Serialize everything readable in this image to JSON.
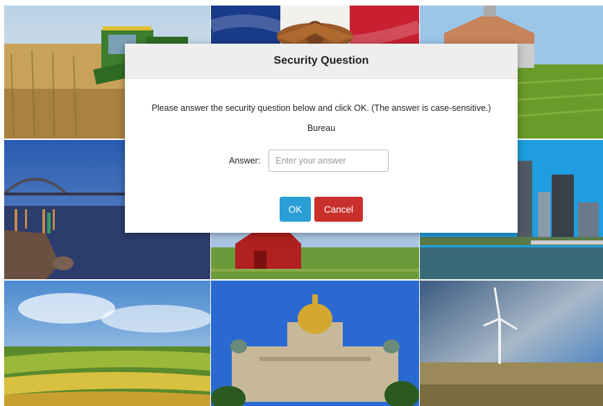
{
  "background": {
    "tiles": [
      {
        "name": "corn-harvest"
      },
      {
        "name": "iowa-flag"
      },
      {
        "name": "barn-cornfield"
      },
      {
        "name": "bridge-river"
      },
      {
        "name": "red-barn"
      },
      {
        "name": "city-skyline"
      },
      {
        "name": "farm-fields"
      },
      {
        "name": "state-capitol"
      },
      {
        "name": "wind-turbine"
      }
    ]
  },
  "dialog": {
    "title": "Security Question",
    "instructions": "Please answer the security question below and click OK. (The answer is case-sensitive.)",
    "question": "Bureau",
    "answer_label": "Answer:",
    "answer_placeholder": "Enter your answer",
    "answer_value": "",
    "ok_label": "OK",
    "cancel_label": "Cancel"
  },
  "colors": {
    "ok_button": "#2a9fd6",
    "cancel_button": "#c9302c",
    "header_bg": "#eeeeee"
  }
}
